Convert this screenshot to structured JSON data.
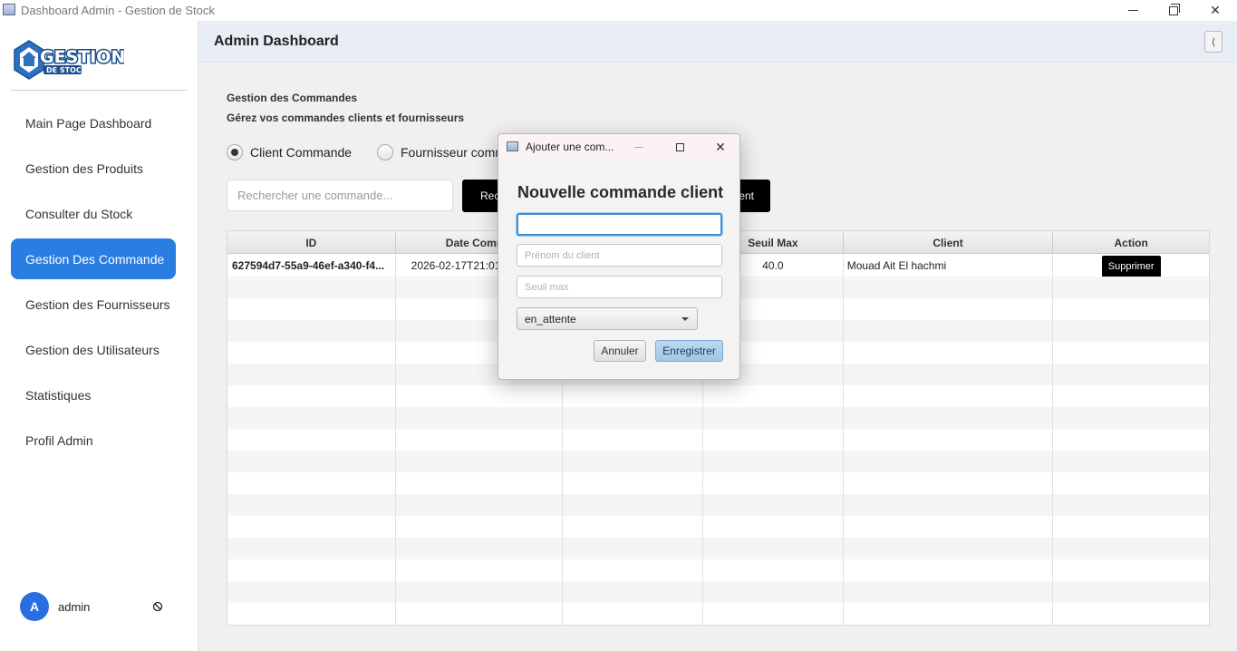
{
  "window": {
    "title": "Dashboard Admin - Gestion de Stock"
  },
  "logo": {
    "text_main": "GESTION",
    "text_sub": "DE STOCK"
  },
  "sidebar": {
    "items": [
      {
        "label": "Main Page Dashboard",
        "active": false
      },
      {
        "label": "Gestion des Produits",
        "active": false
      },
      {
        "label": "Consulter du Stock",
        "active": false
      },
      {
        "label": "Gestion Des Commande",
        "active": true
      },
      {
        "label": "Gestion des Fournisseurs",
        "active": false
      },
      {
        "label": "Gestion des Utilisateurs",
        "active": false
      },
      {
        "label": "Statistiques",
        "active": false
      },
      {
        "label": "Profil Admin",
        "active": false
      }
    ],
    "user": {
      "initial": "A",
      "name": "admin"
    }
  },
  "header": {
    "title": "Admin Dashboard",
    "collapse_label": "⟨"
  },
  "main": {
    "section_title": "Gestion des Commandes",
    "section_subtitle": "Gérez vos commandes clients et fournisseurs",
    "radio_client": "Client Commande",
    "radio_fournisseur": "Fournisseur comm",
    "search_placeholder": "Rechercher une commande...",
    "search_button": "Rec",
    "add_button": "ent"
  },
  "table": {
    "columns": [
      "ID",
      "Date Comma",
      "",
      "Seuil Max",
      "Client",
      "Action"
    ],
    "rows": [
      {
        "id": "627594d7-55a9-46ef-a340-f4...",
        "date": "2026-02-17T21:01",
        "fournisseur": "",
        "seuil_max": "40.0",
        "client": "Mouad Ait El hachmi",
        "action": "Supprimer"
      }
    ]
  },
  "dialog": {
    "title": "Ajouter une com...",
    "heading": "Nouvelle commande client",
    "field1_value": "",
    "prenom_placeholder": "Prénom du client",
    "seuil_placeholder": "Seuil max",
    "status_value": "en_attente",
    "cancel_label": "Annuler",
    "save_label": "Enregistrer"
  }
}
